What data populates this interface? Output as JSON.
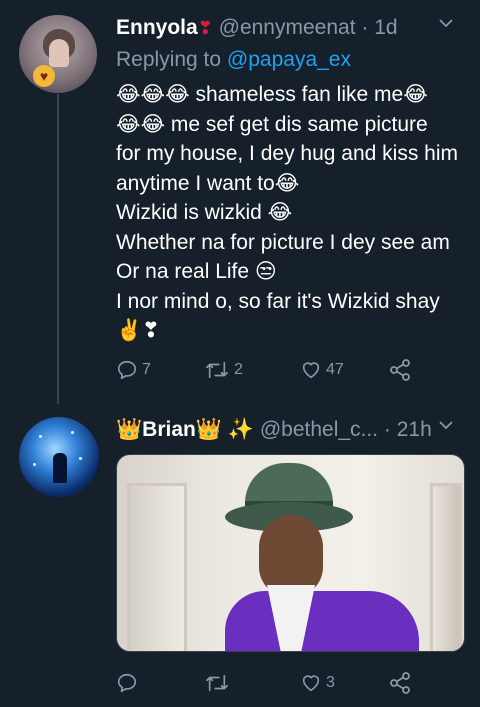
{
  "tweets": [
    {
      "name": "Ennyola",
      "name_emoji": "❣",
      "handle": "@ennymeenat",
      "separator": "·",
      "time": "1d",
      "replying_prefix": "Replying to",
      "replying_to": "@papaya_ex",
      "lines": [
        "😂😂😂 shameless fan like me😂",
        "😂😂 me sef get dis same picture",
        "for my house, I dey hug and kiss him",
        "anytime I want to😂",
        "Wizkid is wizkid 😂",
        "Whether na for picture I dey see am",
        "Or na real Life 😒",
        "I nor mind o, so far it's Wizkid shay",
        "✌️❣"
      ],
      "reply_count": "7",
      "retweet_count": "2",
      "like_count": "47",
      "share_count": ""
    },
    {
      "name": "👑Brian👑",
      "name_suffix": "✨",
      "handle": "@bethel_c...",
      "separator": "·",
      "time": "21h",
      "reply_count": "",
      "retweet_count": "",
      "like_count": "3",
      "share_count": ""
    }
  ],
  "colors": {
    "background": "#15202b",
    "text": "#ffffff",
    "secondary": "#8899a6",
    "link": "#1da1f2",
    "divider": "#38444d"
  },
  "icons": {
    "chevron": "chevron-down-icon",
    "reply": "reply-icon",
    "retweet": "retweet-icon",
    "like": "heart-icon",
    "share": "share-icon"
  }
}
